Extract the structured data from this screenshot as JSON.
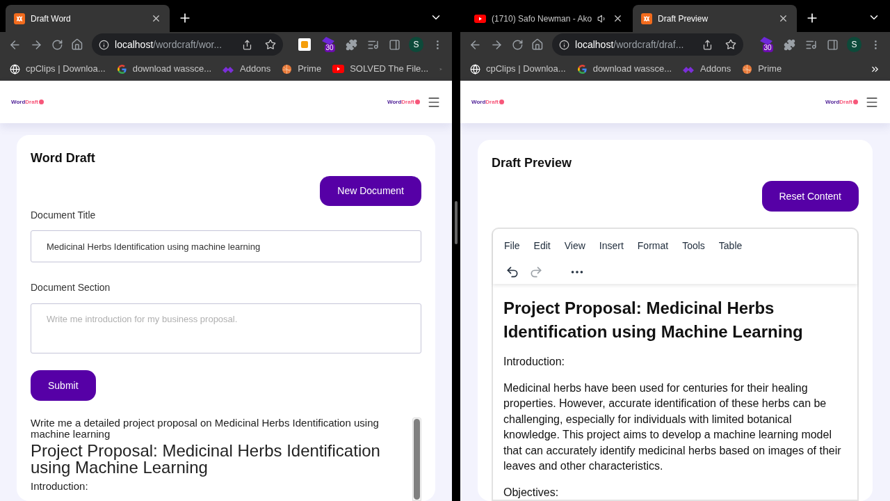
{
  "windows": [
    {
      "tabs": [
        {
          "title": "Draft Word",
          "kind": "xampp",
          "selected": true,
          "audio": false
        }
      ],
      "address": {
        "host": "localhost",
        "path": "/wordcraft/wor..."
      },
      "toolbar_extensions": [
        {
          "kind": "square"
        },
        {
          "kind": "badge",
          "badge": "30"
        },
        {
          "kind": "puzzle"
        },
        {
          "kind": "playlist"
        },
        {
          "kind": "sidepanel"
        }
      ],
      "profile": "S",
      "bookmarks": [
        {
          "label": "cpClips | Downloa...",
          "kind": "globe"
        },
        {
          "label": "download wassce...",
          "kind": "google"
        },
        {
          "label": "Addons",
          "kind": "addons"
        },
        {
          "label": "Prime",
          "kind": "prime"
        },
        {
          "label": "SOLVED The File...",
          "kind": "youtube"
        }
      ],
      "app": {
        "kind": "form",
        "logos": [
          {
            "word": "Word",
            "draft": "Draft"
          },
          {
            "word": "Word",
            "draft": "Draft"
          }
        ],
        "title": "Word Draft",
        "action": "New Document",
        "fields": [
          {
            "label": "Document Title",
            "value": "Medicinal Herbs Identification using machine learning",
            "kind": "input"
          },
          {
            "label": "Document Section",
            "placeholder": "Write me introduction for my business proposal.",
            "kind": "textarea"
          }
        ],
        "submit": "Submit",
        "output": {
          "prompt": "Write me a detailed project proposal on Medicinal Herbs Identification using machine learning",
          "heading": "Project Proposal: Medicinal Herbs Identification using Machine Learning",
          "paragraphs": [
            "Introduction:"
          ]
        }
      }
    },
    {
      "tabs": [
        {
          "title": "(1710) Safo Newman - Ako",
          "kind": "youtube",
          "selected": false,
          "audio": true
        },
        {
          "title": "Draft Preview",
          "kind": "xampp",
          "selected": true,
          "audio": false
        }
      ],
      "address": {
        "host": "localhost",
        "path": "/wordcraft/draf..."
      },
      "toolbar_extensions": [
        {
          "kind": "badge",
          "badge": "30"
        },
        {
          "kind": "puzzle"
        },
        {
          "kind": "playlist"
        },
        {
          "kind": "sidepanel"
        }
      ],
      "profile": "S",
      "bookmarks": [
        {
          "label": "cpClips | Downloa...",
          "kind": "globe"
        },
        {
          "label": "download wassce...",
          "kind": "google"
        },
        {
          "label": "Addons",
          "kind": "addons"
        },
        {
          "label": "Prime",
          "kind": "prime"
        }
      ],
      "app": {
        "kind": "preview",
        "logos": [
          {
            "word": "Word",
            "draft": "Draft"
          },
          {
            "word": "Word",
            "draft": "Draft"
          }
        ],
        "title": "Draft Preview",
        "action": "Reset Content",
        "menu": [
          "File",
          "Edit",
          "View",
          "Insert",
          "Format",
          "Tools",
          "Table"
        ],
        "undo": {
          "disabled": false
        },
        "redo": {
          "disabled": true
        },
        "document": {
          "heading": "Project Proposal: Medicinal Herbs Identification using Machine Learning",
          "paragraphs": [
            "Introduction:",
            "Medicinal herbs have been used for centuries for their healing properties. However, accurate identification of these herbs can be challenging, especially for individuals with limited botanical knowledge. This project aims to develop a machine learning model that can accurately identify medicinal herbs based on images of their leaves and other characteristics.",
            "Objectives:"
          ]
        }
      }
    }
  ]
}
